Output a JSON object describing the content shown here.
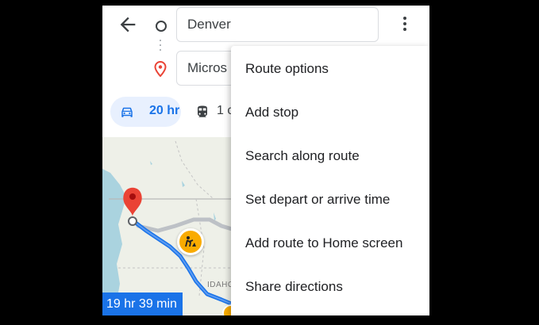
{
  "search": {
    "origin_value": "Denver",
    "destination_value": "Micros"
  },
  "modes": {
    "drive_label": "20 hr",
    "transit_label": "1 c"
  },
  "map": {
    "region_label": "IDAHO",
    "duration_label": "19 hr 39 min"
  },
  "menu": {
    "items": [
      {
        "label": "Route options"
      },
      {
        "label": "Add stop"
      },
      {
        "label": "Search along route"
      },
      {
        "label": "Set depart or arrive time"
      },
      {
        "label": "Add route to Home screen"
      },
      {
        "label": "Share directions"
      }
    ]
  },
  "colors": {
    "accent": "#1a73e8",
    "pin": "#ea4335",
    "construction": "#f9ab00"
  }
}
